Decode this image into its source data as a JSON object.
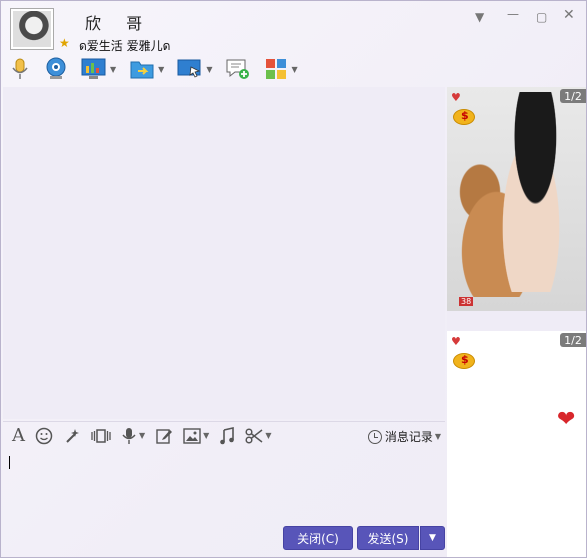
{
  "header": {
    "contact_name": "欣 哥",
    "signature": "ด爱生活 爱雅儿ด",
    "window_controls": [
      "dropdown",
      "minimize",
      "maximize",
      "close"
    ]
  },
  "toolbar": {
    "items": [
      {
        "name": "voice-call",
        "icon": "microphone-icon",
        "has_dropdown": false
      },
      {
        "name": "video-call",
        "icon": "webcam-icon",
        "has_dropdown": false
      },
      {
        "name": "remote-assist",
        "icon": "chart-screen-icon",
        "has_dropdown": true
      },
      {
        "name": "send-file",
        "icon": "folder-arrow-icon",
        "has_dropdown": true
      },
      {
        "name": "screen-share",
        "icon": "monitor-icon",
        "has_dropdown": true
      },
      {
        "name": "create-discussion",
        "icon": "chat-add-icon",
        "has_dropdown": false
      },
      {
        "name": "apps",
        "icon": "apps-grid-icon",
        "has_dropdown": true
      }
    ]
  },
  "input_toolbar": {
    "items": [
      "font-icon",
      "emoji-icon",
      "magic-wand-icon",
      "shake-icon",
      "voice-message-icon",
      "edit-icon",
      "image-icon",
      "music-icon",
      "scissors-icon"
    ],
    "history_label": "消息记录"
  },
  "buttons": {
    "close_label": "关闭(C)",
    "send_label": "发送(S)"
  },
  "right_panel": {
    "photo_page": "1/2",
    "second_page": "1/2",
    "level_badge": "38"
  },
  "colors": {
    "accent": "#5855b9",
    "background": "#f0edf7"
  }
}
